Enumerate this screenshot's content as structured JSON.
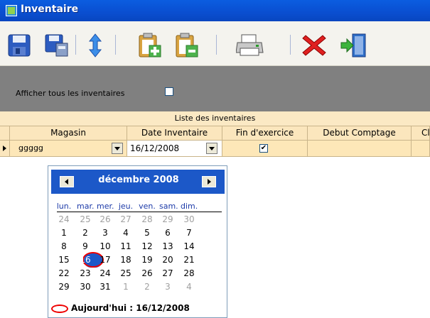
{
  "window": {
    "title": "Inventaire"
  },
  "toolbar": {
    "buttons": [
      {
        "name": "save-icon"
      },
      {
        "name": "save-close-icon"
      },
      {
        "name": "sort-icon"
      },
      {
        "name": "clipboard-add-icon"
      },
      {
        "name": "clipboard-edit-icon"
      },
      {
        "name": "print-icon"
      },
      {
        "name": "delete-icon"
      },
      {
        "name": "exit-icon"
      }
    ]
  },
  "filter": {
    "label": "Afficher tous les inventaires",
    "checked": false
  },
  "grid": {
    "caption": "Liste des inventaires",
    "columns": [
      "Magasin",
      "Date Inventaire",
      "Fin d'exercice",
      "Debut Comptage",
      "Cl"
    ],
    "row": {
      "magasin": "ggggg",
      "date": "16/12/2008",
      "fin_exercice": "✔",
      "debut_comptage": ""
    }
  },
  "calendar": {
    "month": "décembre 2008",
    "weekdays": [
      "lun.",
      "mar.",
      "mer.",
      "jeu.",
      "ven.",
      "sam.",
      "dim."
    ],
    "weeks": [
      [
        "24",
        "25",
        "26",
        "27",
        "28",
        "29",
        "30"
      ],
      [
        "1",
        "2",
        "3",
        "4",
        "5",
        "6",
        "7"
      ],
      [
        "8",
        "9",
        "10",
        "11",
        "12",
        "13",
        "14"
      ],
      [
        "15",
        "16",
        "17",
        "18",
        "19",
        "20",
        "21"
      ],
      [
        "22",
        "23",
        "24",
        "25",
        "26",
        "27",
        "28"
      ],
      [
        "29",
        "30",
        "31",
        "1",
        "2",
        "3",
        "4"
      ]
    ],
    "selected_day": "16",
    "today_label": "Aujourd'hui : 16/12/2008"
  },
  "colors": {
    "titlebar": "#0a4ed0",
    "grid_header": "#fbe6bd",
    "calendar_header": "#1c58c8",
    "today_ring": "#e00000"
  }
}
